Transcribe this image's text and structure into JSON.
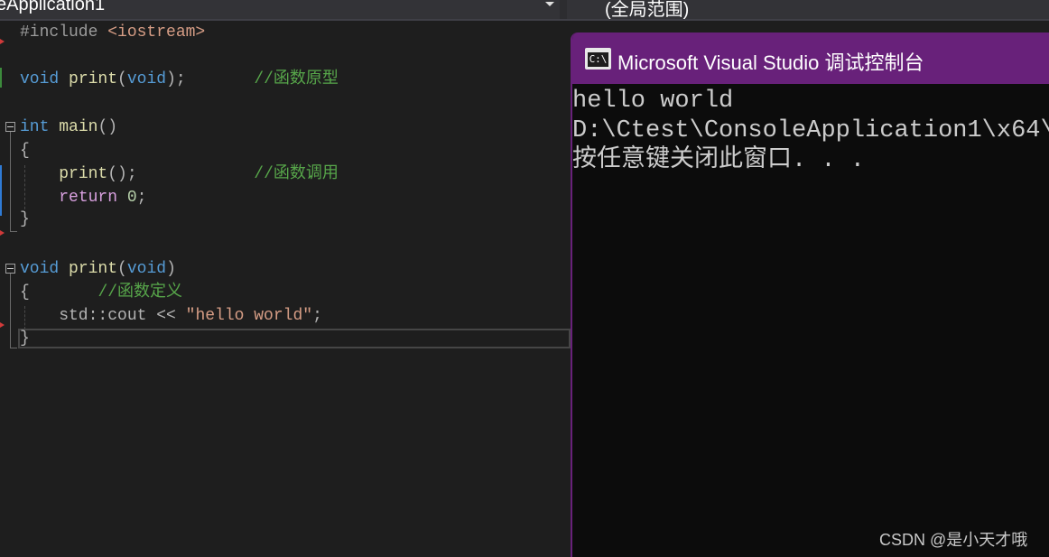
{
  "navbar": {
    "project_scope": "eApplication1",
    "function_scope": "(全局范围)"
  },
  "editor": {
    "lines": [
      {
        "id": "l1",
        "tokens": [
          [
            "pp",
            "#include "
          ],
          [
            "inc",
            "<iostream>"
          ]
        ]
      },
      {
        "id": "l2",
        "tokens": [
          [
            "kw",
            "void"
          ],
          [
            "pl",
            " "
          ],
          [
            "fn",
            "print"
          ],
          [
            "pl",
            "("
          ],
          [
            "kw",
            "void"
          ],
          [
            "pl",
            ");"
          ],
          [
            "pl",
            "       "
          ],
          [
            "cm",
            "//函数原型"
          ]
        ]
      },
      {
        "id": "l3",
        "tokens": [
          [
            "kw",
            "int"
          ],
          [
            "pl",
            " "
          ],
          [
            "fn",
            "main"
          ],
          [
            "pl",
            "()"
          ]
        ]
      },
      {
        "id": "l4",
        "tokens": [
          [
            "pl",
            "{"
          ]
        ]
      },
      {
        "id": "l5",
        "tokens": [
          [
            "pl",
            "    "
          ],
          [
            "fn",
            "print"
          ],
          [
            "pl",
            "();"
          ],
          [
            "pl",
            "            "
          ],
          [
            "cm",
            "//函数调用"
          ]
        ]
      },
      {
        "id": "l6",
        "tokens": [
          [
            "pl",
            "    "
          ],
          [
            "kw2",
            "return"
          ],
          [
            "pl",
            " "
          ],
          [
            "num",
            "0"
          ],
          [
            "pl",
            ";"
          ]
        ]
      },
      {
        "id": "l7",
        "tokens": [
          [
            "pl",
            "}"
          ]
        ]
      },
      {
        "id": "l8",
        "tokens": [
          [
            "kw",
            "void"
          ],
          [
            "pl",
            " "
          ],
          [
            "fn",
            "print"
          ],
          [
            "pl",
            "("
          ],
          [
            "kw",
            "void"
          ],
          [
            "pl",
            ")"
          ]
        ]
      },
      {
        "id": "l9",
        "tokens": [
          [
            "pl",
            "{"
          ],
          [
            "pl",
            "       "
          ],
          [
            "cm",
            "//函数定义"
          ]
        ]
      },
      {
        "id": "l10",
        "tokens": [
          [
            "pl",
            "    std::cout << "
          ],
          [
            "str",
            "\"hello world\""
          ],
          [
            "pl",
            ";"
          ]
        ]
      },
      {
        "id": "l11",
        "tokens": [
          [
            "pl",
            "}"
          ]
        ]
      }
    ]
  },
  "console": {
    "title": "Microsoft Visual Studio 调试控制台",
    "icon_label": "C:\\",
    "output": [
      "hello world",
      "D:\\Ctest\\ConsoleApplication1\\x64\\",
      "按任意键关闭此窗口. . ."
    ]
  },
  "watermark": "CSDN @是小天才哦",
  "colors": {
    "keyword": "#569cd6",
    "control_keyword": "#d8a0df",
    "function": "#dcdcaa",
    "comment": "#57a64a",
    "string": "#d69d85",
    "console_title_bar": "#68217a"
  }
}
